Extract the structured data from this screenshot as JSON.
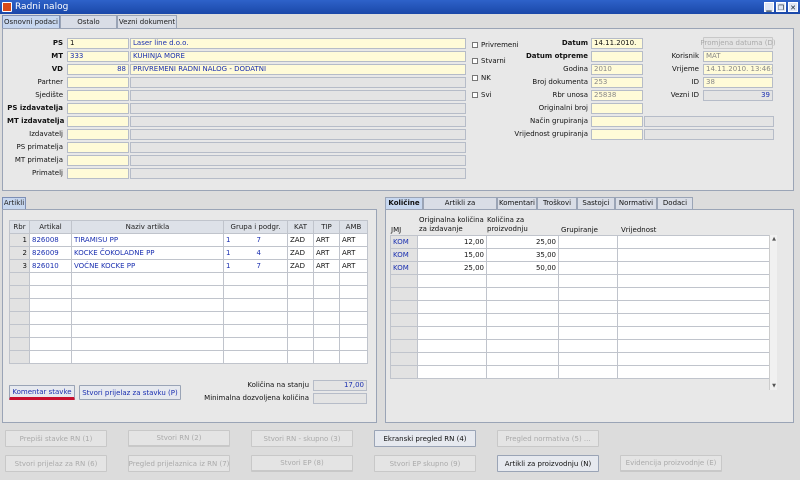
{
  "window": {
    "title": "Radni nalog"
  },
  "tabs": [
    "Osnovni podaci",
    "Ostalo",
    "Vezni dokument"
  ],
  "header": {
    "ps_label": "PS",
    "ps_value": "1",
    "ps_name": "Laser line d.o.o.",
    "mt_label": "MT",
    "mt_value": "333",
    "mt_name": "KUHINJA  MORE",
    "vd_label": "VD",
    "vd_value": "88",
    "vd_name": "PRIVREMENI RADNI NALOG - DODATNI",
    "partner_label": "Partner",
    "sjediste_label": "Sjedište",
    "ps_izdavatelja_label": "PS izdavatelja",
    "mt_izdavatelja_label": "MT izdavatelja",
    "izdavatelj_label": "Izdavatelj",
    "ps_primatelja_label": "PS primatelja",
    "mt_primatelja_label": "MT primatelja",
    "primatelj_label": "Primatelj",
    "chk_privremeni": "Privremeni",
    "chk_stvarni": "Stvarni",
    "chk_nk": "NK",
    "chk_svi": "Svi",
    "datum_label": "Datum",
    "datum_value": "14.11.2010.",
    "datum_otpreme_label": "Datum otpreme",
    "godina_label": "Godina",
    "godina_value": "2010",
    "broj_dok_label": "Broj dokumenta",
    "broj_dok_value": "253",
    "rbr_unosa_label": "Rbr unosa",
    "rbr_unosa_value": "25838",
    "orig_broj_label": "Originalni broj",
    "nacin_grup_label": "Način grupiranja",
    "vrijednost_grup_label": "Vrijednost grupiranja",
    "promjena_datuma_btn": "Promjena datuma (D)",
    "korisnik_label": "Korisnik",
    "korisnik_value": "MAT",
    "vrijeme_label": "Vrijeme",
    "vrijeme_value": "14.11.2010. 13:46:21",
    "id_label": "ID",
    "id_value": "38",
    "vezni_id_label": "Vezni ID",
    "vezni_id_value": "39"
  },
  "artikli": {
    "tab": "Artikli",
    "columns": [
      "Rbr",
      "Artikal",
      "Naziv artikla",
      "Grupa i podgr.",
      "KAT",
      "TIP",
      "AMB"
    ],
    "rows": [
      {
        "rbr": "1",
        "artikal": "826008",
        "naziv": "TIRAMISU PP",
        "grupa": "1",
        "podgr": "7",
        "kat": "ZAD",
        "tip": "ART",
        "amb": "ART"
      },
      {
        "rbr": "2",
        "artikal": "826009",
        "naziv": "KOCKE ČOKOLADNE PP",
        "grupa": "1",
        "podgr": "4",
        "kat": "ZAD",
        "tip": "ART",
        "amb": "ART"
      },
      {
        "rbr": "3",
        "artikal": "826010",
        "naziv": "VOĆNE KOCKE PP",
        "grupa": "1",
        "podgr": "7",
        "kat": "ZAD",
        "tip": "ART",
        "amb": "ART"
      }
    ],
    "btn_komentar": "Komentar stavke",
    "btn_stvori_prijelaz": "Stvori prijelaz za stavku (P)",
    "kolicina_stanje_label": "Količina na stanju",
    "kolicina_stanje_value": "17,00",
    "min_kolicina_label": "Minimalna dozvoljena količina"
  },
  "kolicine": {
    "tabs": [
      "Količine",
      "Artikli za proizvodnju",
      "Komentari",
      "Troškovi",
      "Sastojci",
      "Normativi",
      "Dodaci"
    ],
    "col_jmj": "JMJ",
    "col_orig_1": "Originalna količina",
    "col_orig_2": "za izdavanje",
    "col_kol_1": "Količina za",
    "col_kol_2": "proizvodnju",
    "col_grup": "Grupiranje",
    "col_vrij": "Vrijednost",
    "rows": [
      {
        "jmj": "KOM",
        "orig": "12,00",
        "kol": "25,00"
      },
      {
        "jmj": "KOM",
        "orig": "15,00",
        "kol": "35,00"
      },
      {
        "jmj": "KOM",
        "orig": "25,00",
        "kol": "50,00"
      }
    ]
  },
  "bottom": {
    "b1": "Prepiši stavke RN (1)",
    "b2": "Stvori RN (2)",
    "b3": "Stvori RN - skupno (3)",
    "b4": "Ekranski pregled RN (4)",
    "b5": "Pregled normativa (5) ...",
    "b6": "Stvori prijelaz za RN (6)",
    "b7": "Pregled prijelaznica iz RN (7)",
    "b8": "Stvori EP (8)",
    "b9": "Stvori EP skupno (9)",
    "b10": "Artikli za proizvodnju (N)",
    "b11": "Evidencija proizvodnje (E)"
  }
}
